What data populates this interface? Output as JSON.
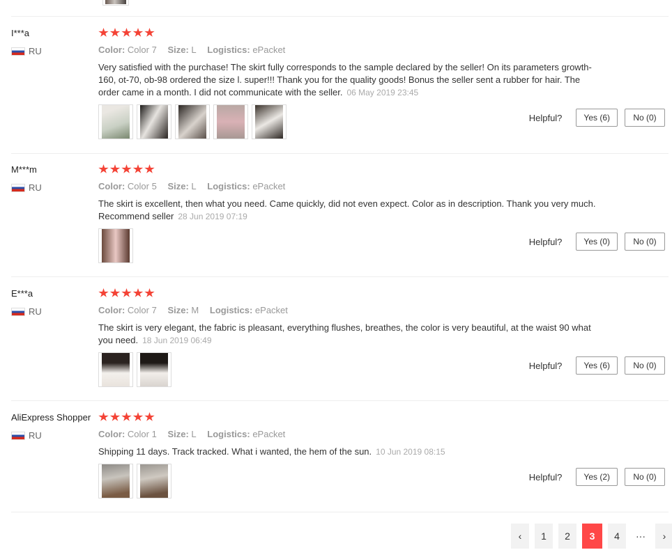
{
  "labels": {
    "color": "Color:",
    "size": "Size:",
    "logistics": "Logistics:",
    "helpful": "Helpful?"
  },
  "reviews": [
    {
      "name": "I***a",
      "country": "RU",
      "rating": 5,
      "color": "Color 7",
      "size": "L",
      "logistics": "ePacket",
      "text": "Very satisfied with the purchase! The skirt fully corresponds to the sample declared by the seller! On its parameters growth-160, ot-70, ob-98 ordered the size l. super!!! Thank you for the quality goods! Bonus the seller sent a rubber for hair. The order came in a month. I did not communicate with the seller.",
      "date": "06 May 2019 23:45",
      "photos": 5,
      "yes": "Yes (6)",
      "no": "No (0)"
    },
    {
      "name": "M***m",
      "country": "RU",
      "rating": 5,
      "color": "Color 5",
      "size": "L",
      "logistics": "ePacket",
      "text": "The skirt is excellent, then what you need. Came quickly, did not even expect. Color as in description. Thank you very much. Recommend seller",
      "date": "28 Jun 2019 07:19",
      "photos": 1,
      "yes": "Yes (0)",
      "no": "No (0)"
    },
    {
      "name": "E***a",
      "country": "RU",
      "rating": 5,
      "color": "Color 7",
      "size": "M",
      "logistics": "ePacket",
      "text": "The skirt is very elegant, the fabric is pleasant, everything flushes, breathes, the color is very beautiful, at the waist 90 what you need.",
      "date": "18 Jun 2019 06:49",
      "photos": 2,
      "yes": "Yes (6)",
      "no": "No (0)"
    },
    {
      "name": "AliExpress Shopper",
      "country": "RU",
      "rating": 5,
      "color": "Color 1",
      "size": "L",
      "logistics": "ePacket",
      "text": "Shipping 11 days. Track tracked. What i wanted, the hem of the sun.",
      "date": "10 Jun 2019 08:15",
      "photos": 2,
      "yes": "Yes (2)",
      "no": "No (0)"
    }
  ],
  "pagination": {
    "prev": "‹",
    "pages": [
      "1",
      "2",
      "3",
      "4"
    ],
    "current": "3",
    "ellipsis": "···",
    "next": "›"
  },
  "colors": {
    "star": "#f44336",
    "active_page": "#ff4747"
  }
}
